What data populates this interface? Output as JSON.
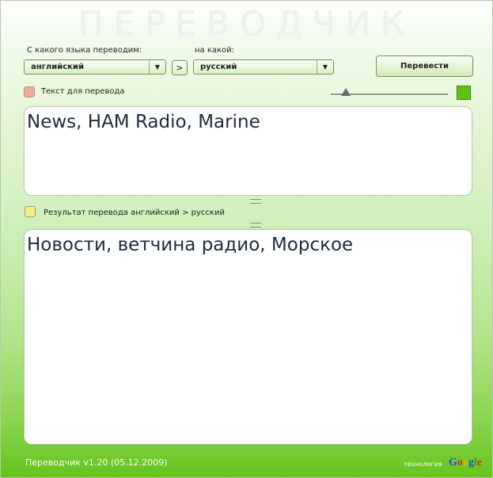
{
  "title": "ПЕРЕВОДЧИК",
  "from_label": "С какого языка переводим:",
  "to_label": "на какой:",
  "from_value": "английский",
  "to_value": "русский",
  "swap_label": ">",
  "translate_label": "Перевести",
  "source_label": "Текст для перевода",
  "result_label": "Результат перевода английский > русский",
  "source_text": "News, HAM Radio, Marine",
  "result_text": "Новости, ветчина радио, Морское",
  "version": "Переводчик v1.20 (05.12.2009)",
  "tech_label": "технология",
  "google": [
    "G",
    "o",
    "o",
    "g",
    "l",
    "e"
  ],
  "colors": {
    "swatch": "#5cc414",
    "source_dot": "#f1a9a0",
    "result_dot": "#f3f088",
    "google": [
      "#1a55c8",
      "#d82a20",
      "#f2b40a",
      "#1a55c8",
      "#2aa02a",
      "#d82a20"
    ]
  }
}
